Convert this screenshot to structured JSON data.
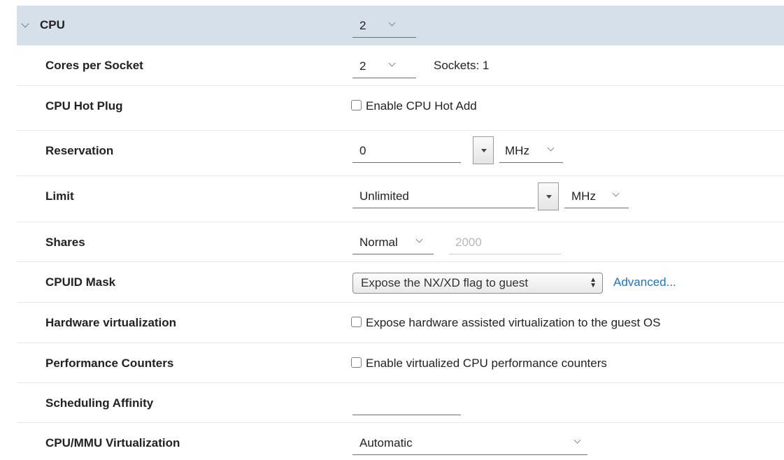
{
  "cpu": {
    "label": "CPU",
    "value": "2",
    "cores_per_socket": {
      "label": "Cores per Socket",
      "value": "2",
      "sockets_text": "Sockets: 1"
    },
    "hot_plug": {
      "label": "CPU Hot Plug",
      "checkbox_label": "Enable CPU Hot Add",
      "checked": false
    },
    "reservation": {
      "label": "Reservation",
      "value": "0",
      "unit": "MHz"
    },
    "limit": {
      "label": "Limit",
      "value": "Unlimited",
      "unit": "MHz"
    },
    "shares": {
      "label": "Shares",
      "level": "Normal",
      "value": "2000"
    },
    "cpuid_mask": {
      "label": "CPUID Mask",
      "selected": "Expose the NX/XD flag to guest",
      "advanced_link": "Advanced..."
    },
    "hw_virtualization": {
      "label": "Hardware virtualization",
      "checkbox_label": "Expose hardware assisted virtualization to the guest OS",
      "checked": false
    },
    "perf_counters": {
      "label": "Performance Counters",
      "checkbox_label": "Enable virtualized CPU performance counters",
      "checked": false
    },
    "scheduling_affinity": {
      "label": "Scheduling Affinity",
      "value": ""
    },
    "mmu_virtualization": {
      "label": "CPU/MMU Virtualization",
      "value": "Automatic"
    }
  },
  "colors": {
    "header_bg": "#d6e0ea",
    "link": "#1a73c4",
    "row_divider": "#e6e6e6"
  },
  "icons": {
    "expand": "chevron-down-icon",
    "dropdown": "chevron-down-icon",
    "spinner": "triangle-down-icon",
    "select_arrows": "up-down-arrows-icon"
  }
}
